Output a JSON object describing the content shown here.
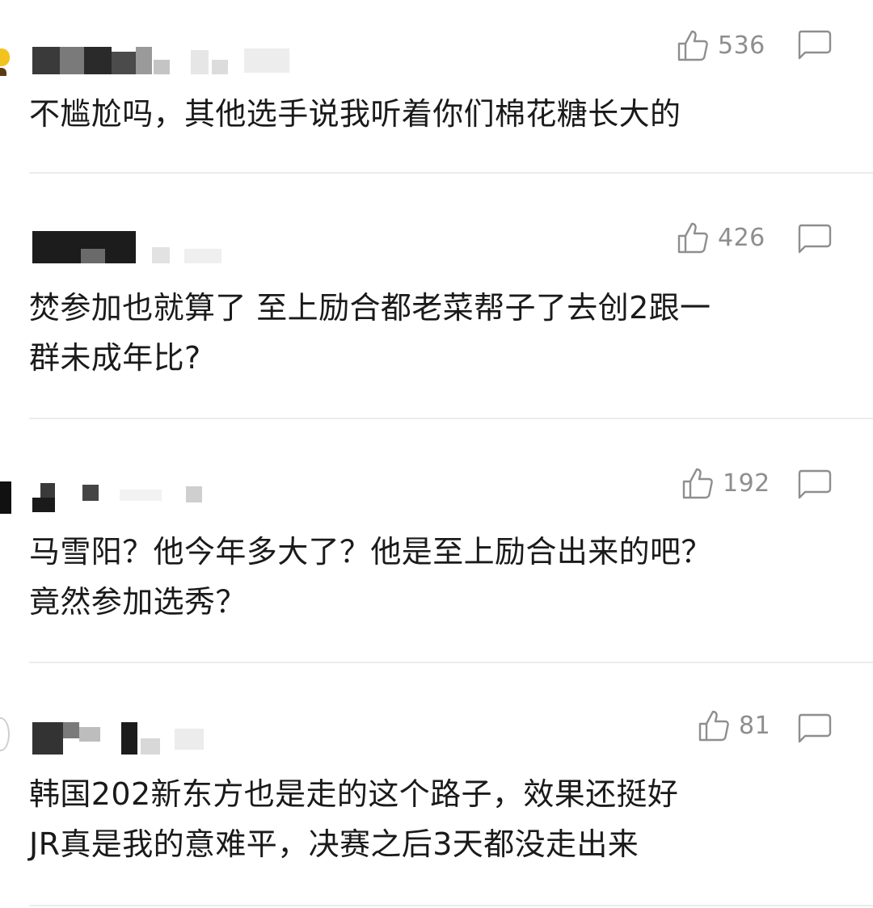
{
  "comments": [
    {
      "like_count": "536",
      "text": "不尴尬吗，其他选手说我听着你们棉花糖长大的"
    },
    {
      "like_count": "426",
      "text": "焚参加也就算了  至上励合都老菜帮子了去创2跟一\n群未成年比?"
    },
    {
      "like_count": "192",
      "text": "马雪阳？他今年多大了？他是至上励合出来的吧？\n竟然参加选秀？"
    },
    {
      "like_count": "81",
      "text": "韩国202新东方也是走的这个路子，效果还挺好\nJR真是我的意难平，决赛之后3天都没走出来"
    }
  ],
  "icons": {
    "like": "thumbs-up-outline-icon",
    "reply": "speech-bubble-outline-icon"
  },
  "colors": {
    "text": "#1a1a1a",
    "meta": "#8e8e8e",
    "divider": "#ececec"
  }
}
